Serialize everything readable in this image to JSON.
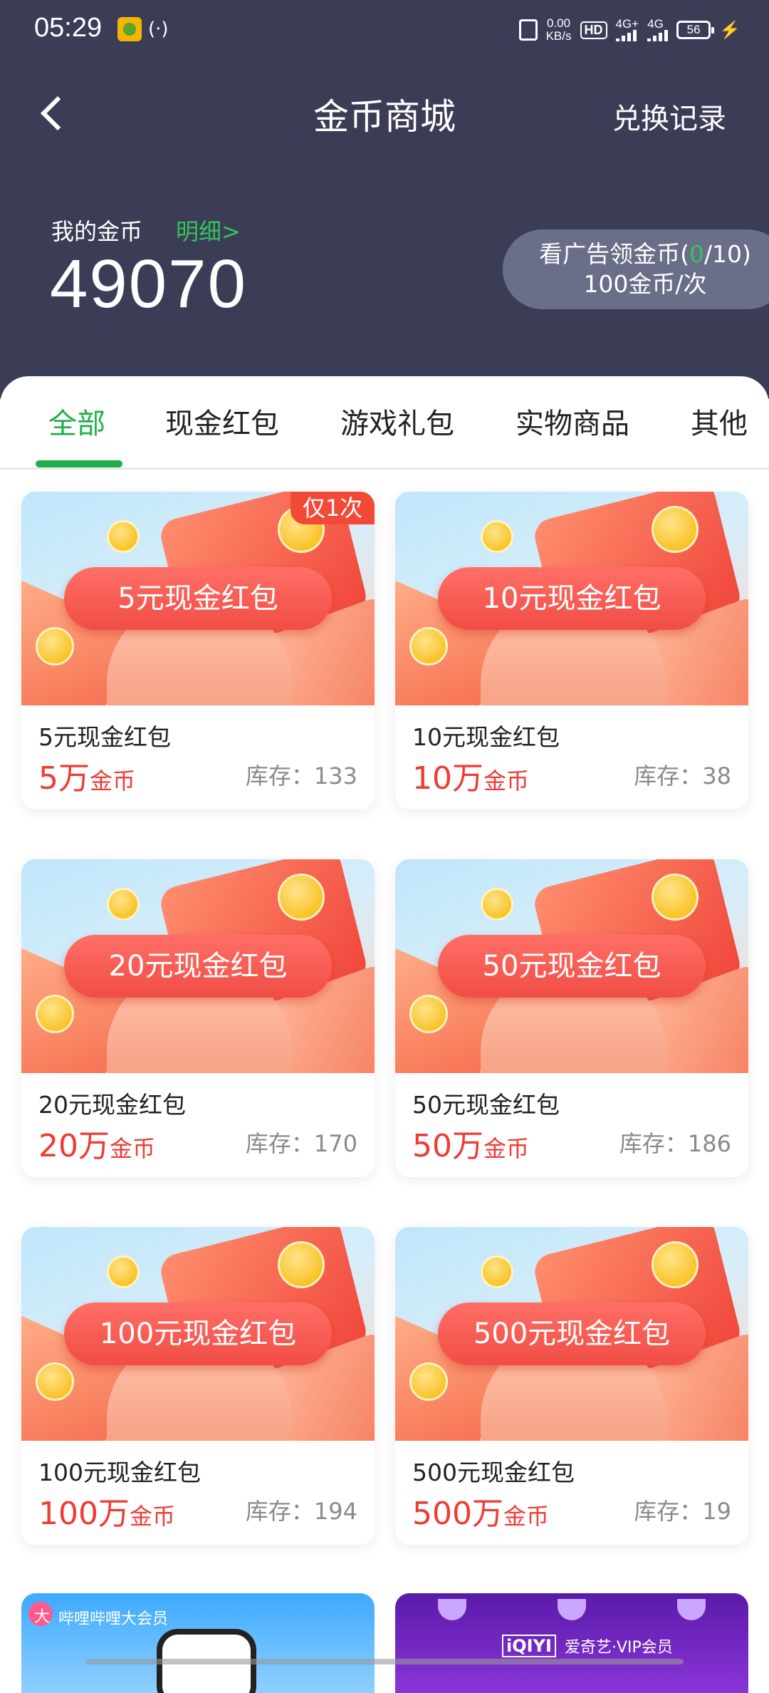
{
  "status_bar": {
    "time": "05:29",
    "hotspot_symbol": "(·)",
    "speed_value": "0.00",
    "speed_unit": "KB/s",
    "hd_label": "HD",
    "network_1": "4G+",
    "network_2": "4G",
    "battery": "56",
    "charging_symbol": "⚡"
  },
  "header": {
    "title": "金币商城",
    "exchange_record": "兑换记录"
  },
  "coins": {
    "label": "我的金币",
    "detail_link": "明细>",
    "balance": "49070"
  },
  "ad_reward": {
    "line1_prefix": "看广告领金币(",
    "watched": "0",
    "line1_suffix": "/10)",
    "line2": "100金币/次"
  },
  "tabs": [
    {
      "label": "全部",
      "active": true
    },
    {
      "label": "现金红包",
      "active": false
    },
    {
      "label": "游戏礼包",
      "active": false
    },
    {
      "label": "实物商品",
      "active": false
    },
    {
      "label": "其他",
      "active": false
    }
  ],
  "products": [
    {
      "image_label": "5元现金红包",
      "name": "5元现金红包",
      "price": "5万",
      "price_unit": "金币",
      "stock": "库存：133",
      "badge": "仅1次"
    },
    {
      "image_label": "10元现金红包",
      "name": "10元现金红包",
      "price": "10万",
      "price_unit": "金币",
      "stock": "库存：38"
    },
    {
      "image_label": "20元现金红包",
      "name": "20元现金红包",
      "price": "20万",
      "price_unit": "金币",
      "stock": "库存：170"
    },
    {
      "image_label": "50元现金红包",
      "name": "50元现金红包",
      "price": "50万",
      "price_unit": "金币",
      "stock": "库存：186"
    },
    {
      "image_label": "100元现金红包",
      "name": "100元现金红包",
      "price": "100万",
      "price_unit": "金币",
      "stock": "库存：194"
    },
    {
      "image_label": "500元现金红包",
      "name": "500元现金红包",
      "price": "500万",
      "price_unit": "金币",
      "stock": "库存：19"
    }
  ],
  "partial_items": [
    {
      "badge": "大",
      "label": "哔哩哔哩大会员"
    },
    {
      "logo": "iQIYI",
      "label": "爱奇艺·VIP会员"
    }
  ],
  "colors": {
    "header_bg": "#3b3d57",
    "accent_green": "#1fae4a",
    "price_red": "#ef3b36"
  }
}
